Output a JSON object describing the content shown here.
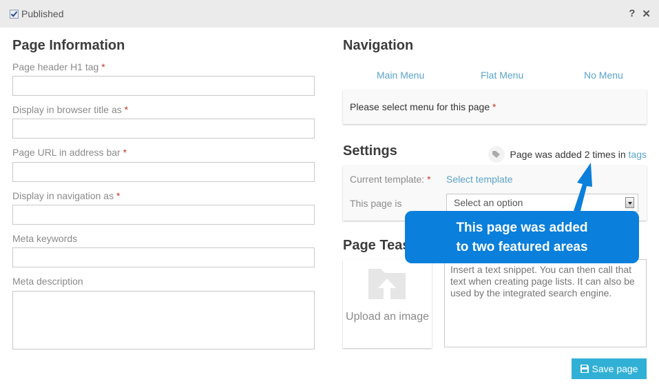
{
  "topbar": {
    "published_label": "Published",
    "published_checked": true,
    "help_icon": "?",
    "close_icon": "✕"
  },
  "page_info": {
    "title": "Page Information",
    "fields": [
      {
        "label": "Page header H1 tag",
        "required": "*",
        "value": ""
      },
      {
        "label": "Display in browser title as",
        "required": "*",
        "value": ""
      },
      {
        "label": "Page URL in address bar",
        "required": "*",
        "value": ""
      },
      {
        "label": "Display in navigation as",
        "required": "*",
        "value": ""
      },
      {
        "label": "Meta keywords",
        "value": ""
      },
      {
        "label": "Meta description",
        "value": ""
      }
    ]
  },
  "navigation": {
    "title": "Navigation",
    "tabs": [
      "Main Menu",
      "Flat Menu",
      "No Menu"
    ],
    "prompt": "Please select menu for this page",
    "required": "*"
  },
  "settings": {
    "title": "Settings",
    "tag_text": "Page was added 2 times in",
    "tag_link": "tags",
    "template_label": "Current template:",
    "required": "*",
    "template_link": "Select template",
    "page_is_label": "This page is",
    "page_is_value": "Select an option"
  },
  "teaser": {
    "title": "Page Teaser",
    "upload_label": "Upload an image",
    "placeholder": "Insert a text snippet. You can then call that text when creating page lists. It can also be used by the integrated search engine."
  },
  "actions": {
    "save_label": "Save page"
  },
  "callout": {
    "line1": "This page was added",
    "line2": "to two featured areas",
    "color": "#0a7fdb"
  }
}
